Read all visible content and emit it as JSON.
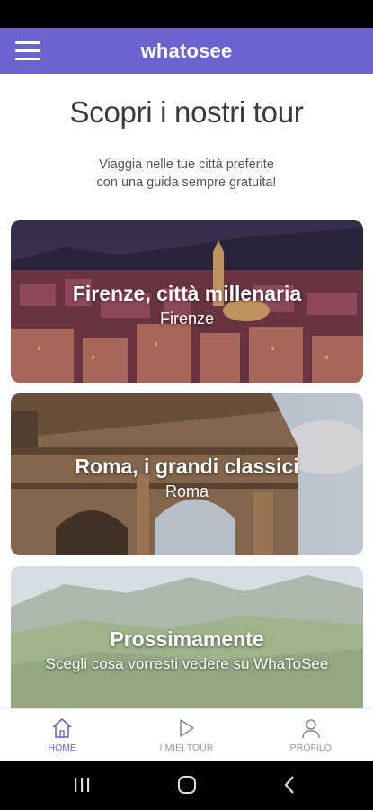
{
  "app": {
    "title": "whatosee"
  },
  "colors": {
    "accent": "#6b63d0",
    "heading": "#3a3a3a",
    "nav_inactive": "#9a9a9a"
  },
  "menu": {
    "icon": "hamburger-menu-icon"
  },
  "intro": {
    "heading": "Scopri i nostri tour",
    "subtitle_line1": "Viaggia nelle tue città preferite",
    "subtitle_line2": "con una guida sempre gratuita!"
  },
  "tours": [
    {
      "title": "Firenze, città millenaria",
      "city": "Firenze"
    },
    {
      "title": "Roma, i grandi classici",
      "city": "Roma"
    },
    {
      "title": "Prossimamente",
      "city": "Scegli cosa vorresti vedere su WhaToSee"
    }
  ],
  "bottom_nav": [
    {
      "label": "HOME",
      "icon": "home-icon",
      "active": true
    },
    {
      "label": "I MIEI TOUR",
      "icon": "play-icon",
      "active": false
    },
    {
      "label": "PROFILO",
      "icon": "user-icon",
      "active": false
    }
  ],
  "system_nav": [
    "recent-apps-icon",
    "home-circle-icon",
    "back-icon"
  ]
}
